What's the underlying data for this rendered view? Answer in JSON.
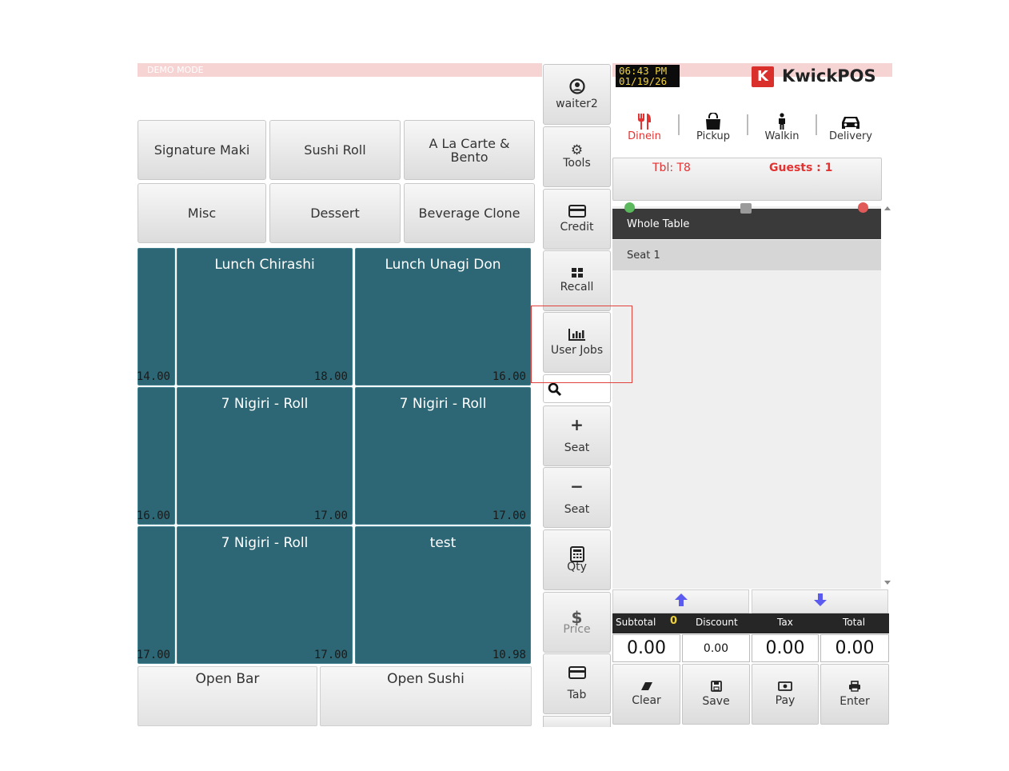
{
  "banner": {
    "demo_mode": "DEMO MODE"
  },
  "categories": [
    {
      "label": "Signature Maki"
    },
    {
      "label": "Sushi Roll"
    },
    {
      "label": "A La Carte & Bento"
    },
    {
      "label": "Misc"
    },
    {
      "label": "Dessert"
    },
    {
      "label": "Beverage Clone"
    }
  ],
  "items": [
    {
      "name": "",
      "price": "14.00"
    },
    {
      "name": "Lunch Chirashi",
      "price": "18.00"
    },
    {
      "name": "Lunch Unagi Don",
      "price": "16.00"
    },
    {
      "name": "",
      "price": "16.00"
    },
    {
      "name": "7 Nigiri - Roll",
      "price": "17.00"
    },
    {
      "name": "7 Nigiri - Roll",
      "price": "17.00"
    },
    {
      "name": "",
      "price": "17.00"
    },
    {
      "name": "7 Nigiri - Roll",
      "price": "17.00"
    },
    {
      "name": "test",
      "price": "10.98"
    }
  ],
  "bottom_buttons": [
    {
      "label": "Open Bar"
    },
    {
      "label": "Open Sushi"
    }
  ],
  "side_menu": {
    "user": "waiter2",
    "tools": "Tools",
    "credit": "Credit",
    "recall": "Recall",
    "user_jobs": "User Jobs",
    "add_seat": "Seat",
    "remove_seat": "Seat",
    "qty": "Qty",
    "price": "Price",
    "tab": "Tab"
  },
  "clock": {
    "time": "06:43 PM",
    "date": "01/19/26"
  },
  "brand": {
    "logo_letter": "K",
    "name": "KwickPOS",
    "accent": "#d9302c"
  },
  "order_types": [
    {
      "label": "Dinein",
      "icon": "utensils-icon",
      "active": true
    },
    {
      "label": "Pickup",
      "icon": "bag-icon",
      "active": false
    },
    {
      "label": "Walkin",
      "icon": "person-icon",
      "active": false
    },
    {
      "label": "Delivery",
      "icon": "car-icon",
      "active": false
    }
  ],
  "table": {
    "tbl": "Tbl: T8",
    "guests": "Guests : 1"
  },
  "seats": [
    {
      "label": "Whole Table"
    },
    {
      "label": "Seat 1"
    }
  ],
  "totals": {
    "subtotal_label": "Subtotal",
    "item_count": "0",
    "discount_label": "Discount",
    "tax_label": "Tax",
    "total_label": "Total",
    "subtotal": "0.00",
    "discount": "0.00",
    "tax": "0.00",
    "total": "0.00"
  },
  "actions": {
    "clear": "Clear",
    "save": "Save",
    "pay": "Pay",
    "enter": "Enter"
  }
}
